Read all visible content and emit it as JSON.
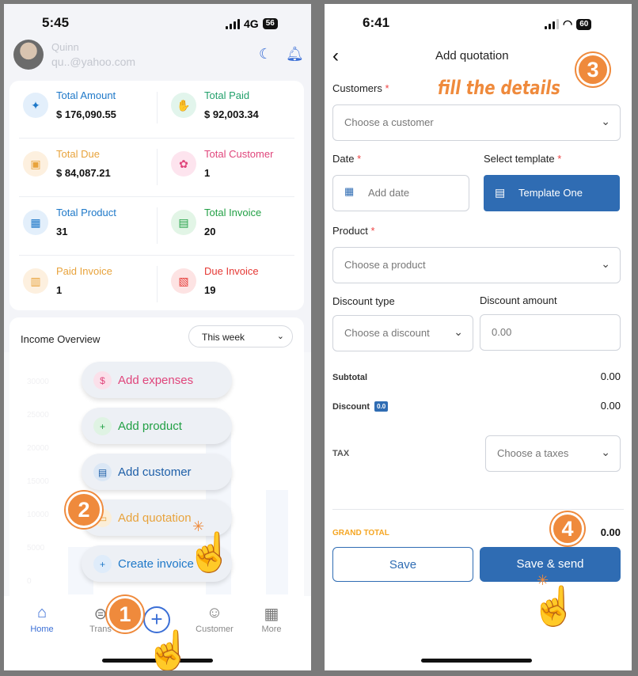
{
  "left": {
    "status": {
      "time": "5:45",
      "network": "4G",
      "battery": "56"
    },
    "user": {
      "name": "Quinn",
      "email": "qu..@yahoo.com"
    },
    "stats": [
      {
        "label": "Total Amount",
        "value": "$ 176,090.55",
        "color": "#1e78c8",
        "bg": "#e3effb",
        "icon": "✦"
      },
      {
        "label": "Total Paid",
        "value": "$ 92,003.34",
        "color": "#22a06b",
        "bg": "#e2f5ec",
        "icon": "✋"
      },
      {
        "label": "Total Due",
        "value": "$ 84,087.21",
        "color": "#e8a33c",
        "bg": "#fdf0df",
        "icon": "▣"
      },
      {
        "label": "Total Customer",
        "value": "1",
        "color": "#e0457b",
        "bg": "#fde4ee",
        "icon": "✿"
      },
      {
        "label": "Total Product",
        "value": "31",
        "color": "#1e78c8",
        "bg": "#e3effb",
        "icon": "▦"
      },
      {
        "label": "Total Invoice",
        "value": "20",
        "color": "#22a045",
        "bg": "#e2f5e6",
        "icon": "▤"
      },
      {
        "label": "Paid Invoice",
        "value": "1",
        "color": "#e8a33c",
        "bg": "#fdf0df",
        "icon": "▥"
      },
      {
        "label": "Due Invoice",
        "value": "19",
        "color": "#e53935",
        "bg": "#fde3e3",
        "icon": "▧"
      }
    ],
    "income": {
      "title": "Income Overview",
      "period": "This week",
      "ylabels": [
        "30000",
        "25000",
        "20000",
        "15000",
        "10000",
        "5000",
        "0"
      ]
    },
    "fab_menu": [
      {
        "label": "Add expenses",
        "color": "#e0457b",
        "bg": "#fbe0ea",
        "icon": "$"
      },
      {
        "label": "Add product",
        "color": "#22a045",
        "bg": "#dff3e3",
        "icon": "+"
      },
      {
        "label": "Add customer",
        "color": "#1e5fa8",
        "bg": "#dbe7f5",
        "icon": "▤"
      },
      {
        "label": "Add quotation",
        "color": "#e8a33c",
        "bg": "#fbeed8",
        "icon": "▭"
      },
      {
        "label": "Create invoice",
        "color": "#1e78c8",
        "bg": "#dfecfa",
        "icon": "+"
      }
    ],
    "nav": {
      "home": "Home",
      "trans": "Trans",
      "customer": "Customer",
      "more": "More"
    },
    "steps": [
      "2",
      "1"
    ]
  },
  "right": {
    "status": {
      "time": "6:41",
      "battery": "60"
    },
    "title": "Add quotation",
    "annotation": "fill the details",
    "steps": [
      "3",
      "4"
    ],
    "customers": {
      "label": "Customers",
      "required": "*",
      "placeholder": "Choose a customer"
    },
    "date": {
      "label": "Date",
      "required": "*",
      "placeholder": "Add date"
    },
    "template": {
      "label": "Select template",
      "required": "*",
      "value": "Template One"
    },
    "product": {
      "label": "Product",
      "required": "*",
      "placeholder": "Choose a product"
    },
    "discount_type": {
      "label": "Discount type",
      "placeholder": "Choose a discount"
    },
    "discount_amount": {
      "label": "Discount amount",
      "placeholder": "0.00"
    },
    "subtotal": {
      "label": "Subtotal",
      "value": "0.00"
    },
    "discount": {
      "label": "Discount",
      "badge": "0.0",
      "value": "0.00"
    },
    "tax": {
      "label": "TAX",
      "placeholder": "Choose a taxes"
    },
    "grand_total": {
      "label": "GRAND TOTAL",
      "value": "0.00"
    },
    "buttons": {
      "save": "Save",
      "send": "Save & send"
    }
  }
}
